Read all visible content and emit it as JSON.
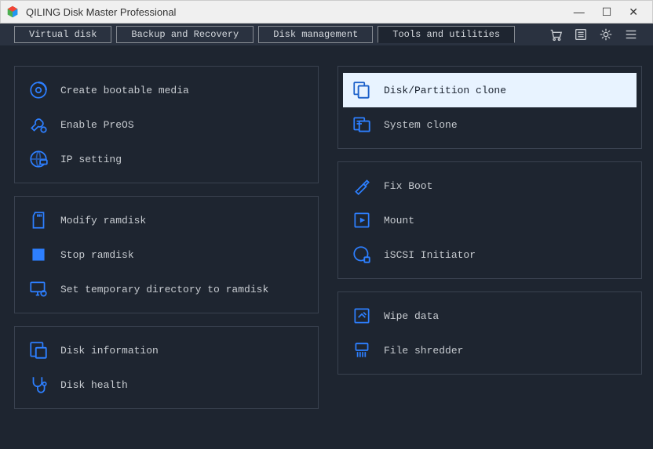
{
  "app": {
    "title": "QILING Disk Master Professional"
  },
  "tabs": [
    "Virtual disk",
    "Backup and Recovery",
    "Disk management",
    "Tools and utilities"
  ],
  "activeTab": 3,
  "left": {
    "g1": [
      {
        "label": "Create bootable media"
      },
      {
        "label": "Enable PreOS"
      },
      {
        "label": "IP setting"
      }
    ],
    "g2": [
      {
        "label": "Modify ramdisk"
      },
      {
        "label": "Stop ramdisk"
      },
      {
        "label": "Set temporary directory to ramdisk"
      }
    ],
    "g3": [
      {
        "label": "Disk information"
      },
      {
        "label": "Disk health"
      }
    ]
  },
  "right": {
    "g1": [
      {
        "label": "Disk/Partition clone",
        "selected": true
      },
      {
        "label": "System clone"
      }
    ],
    "g2": [
      {
        "label": "Fix Boot"
      },
      {
        "label": "Mount"
      },
      {
        "label": "iSCSI Initiator"
      }
    ],
    "g3": [
      {
        "label": "Wipe data"
      },
      {
        "label": "File shredder"
      }
    ]
  }
}
